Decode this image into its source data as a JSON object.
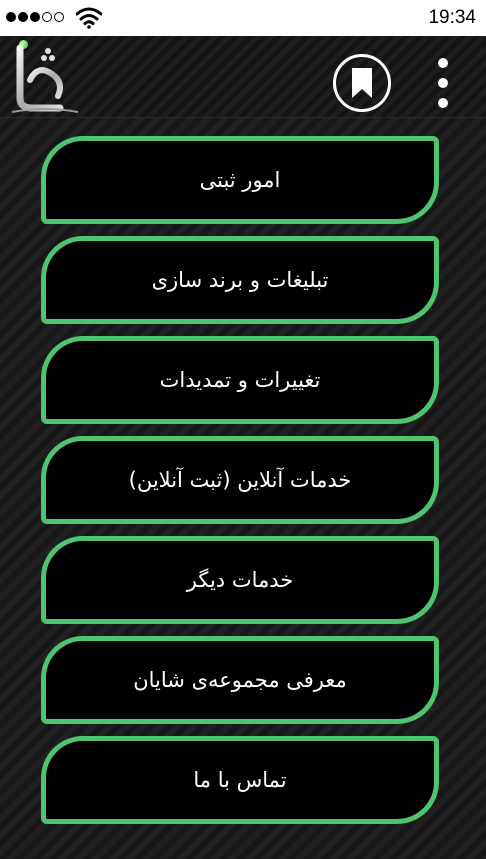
{
  "status_bar": {
    "time": "19:34",
    "signal_bars": 3,
    "signal_total": 5
  },
  "header": {
    "logo_icon": "shayan-logo",
    "bookmark_icon": "bookmark-icon",
    "menu_icon": "overflow-menu-icon"
  },
  "menu": {
    "items": [
      {
        "label": "امور ثبتی"
      },
      {
        "label": "تبلیغات و برند سازی"
      },
      {
        "label": "تغییرات و تمدیدات"
      },
      {
        "label": "خدمات آنلاین (ثبت آنلاین)"
      },
      {
        "label": "خدمات دیگر"
      },
      {
        "label": "معرفی مجموعه‌ی شایان"
      },
      {
        "label": "تماس با ما"
      }
    ]
  },
  "colors": {
    "accent": "#4fc470",
    "button_bg": "#000000",
    "background": "#1b1b1b",
    "status_bar": "#ffffff",
    "status_led": "#27c627"
  }
}
